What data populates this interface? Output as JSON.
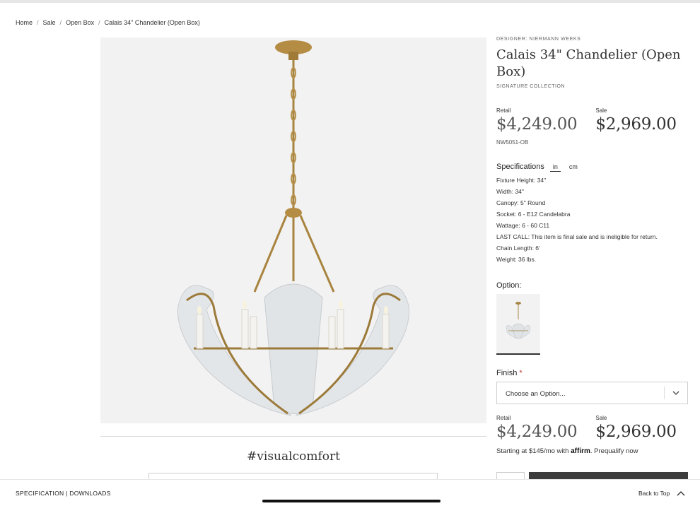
{
  "breadcrumb": {
    "items": [
      "Home",
      "Sale",
      "Open Box",
      "Calais 34\" Chandelier (Open Box)"
    ],
    "separator": "/"
  },
  "product": {
    "designer": "DESIGNER:  NIERMANN WEEKS",
    "title": "Calais 34\" Chandelier (Open Box)",
    "collection": "SIGNATURE COLLECTION",
    "retail_label": "Retail",
    "retail_price": "$4,249.00",
    "sale_label": "Sale",
    "sale_price": "$2,969.00",
    "sku": "NW5051-OB",
    "image_icon": "chandelier-product-image"
  },
  "specifications": {
    "title": "Specifications",
    "unit_in": "in",
    "unit_cm": "cm",
    "active_unit": "in",
    "items": [
      "Fixture Height: 34\"",
      "Width: 34\"",
      "Canopy: 5\" Round",
      "Socket: 6 - E12 Candelabra",
      "Wattage: 6 - 60 C11",
      "LAST CALL: This item is final sale and is ineligible for return.",
      "Chain Length: 6'",
      "Weight: 36 lbs."
    ]
  },
  "option": {
    "label": "Option:",
    "selected_index": 0
  },
  "finish": {
    "label": "Finish",
    "required_mark": "*",
    "placeholder": "Choose an Option...",
    "icon": "chevron-down-icon"
  },
  "bottom_prices": {
    "retail_label": "Retail",
    "retail_price": "$4,249.00",
    "sale_label": "Sale",
    "sale_price": "$2,969.00"
  },
  "financing": {
    "prefix": "Starting at $145/mo with",
    "brand": "affirm",
    "suffix": ". Prequalify now"
  },
  "gallery": {
    "hashtag": "#visualcomfort"
  },
  "footer": {
    "left_label": "SPECIFICATION | DOWNLOADS",
    "back_to_top": "Back to Top",
    "icon": "chevron-up-icon"
  },
  "colors": {
    "image_background": "#f2f2f2",
    "brass": "#b08a45",
    "required": "#c0392b",
    "cart_button": "#3c3c3c"
  }
}
